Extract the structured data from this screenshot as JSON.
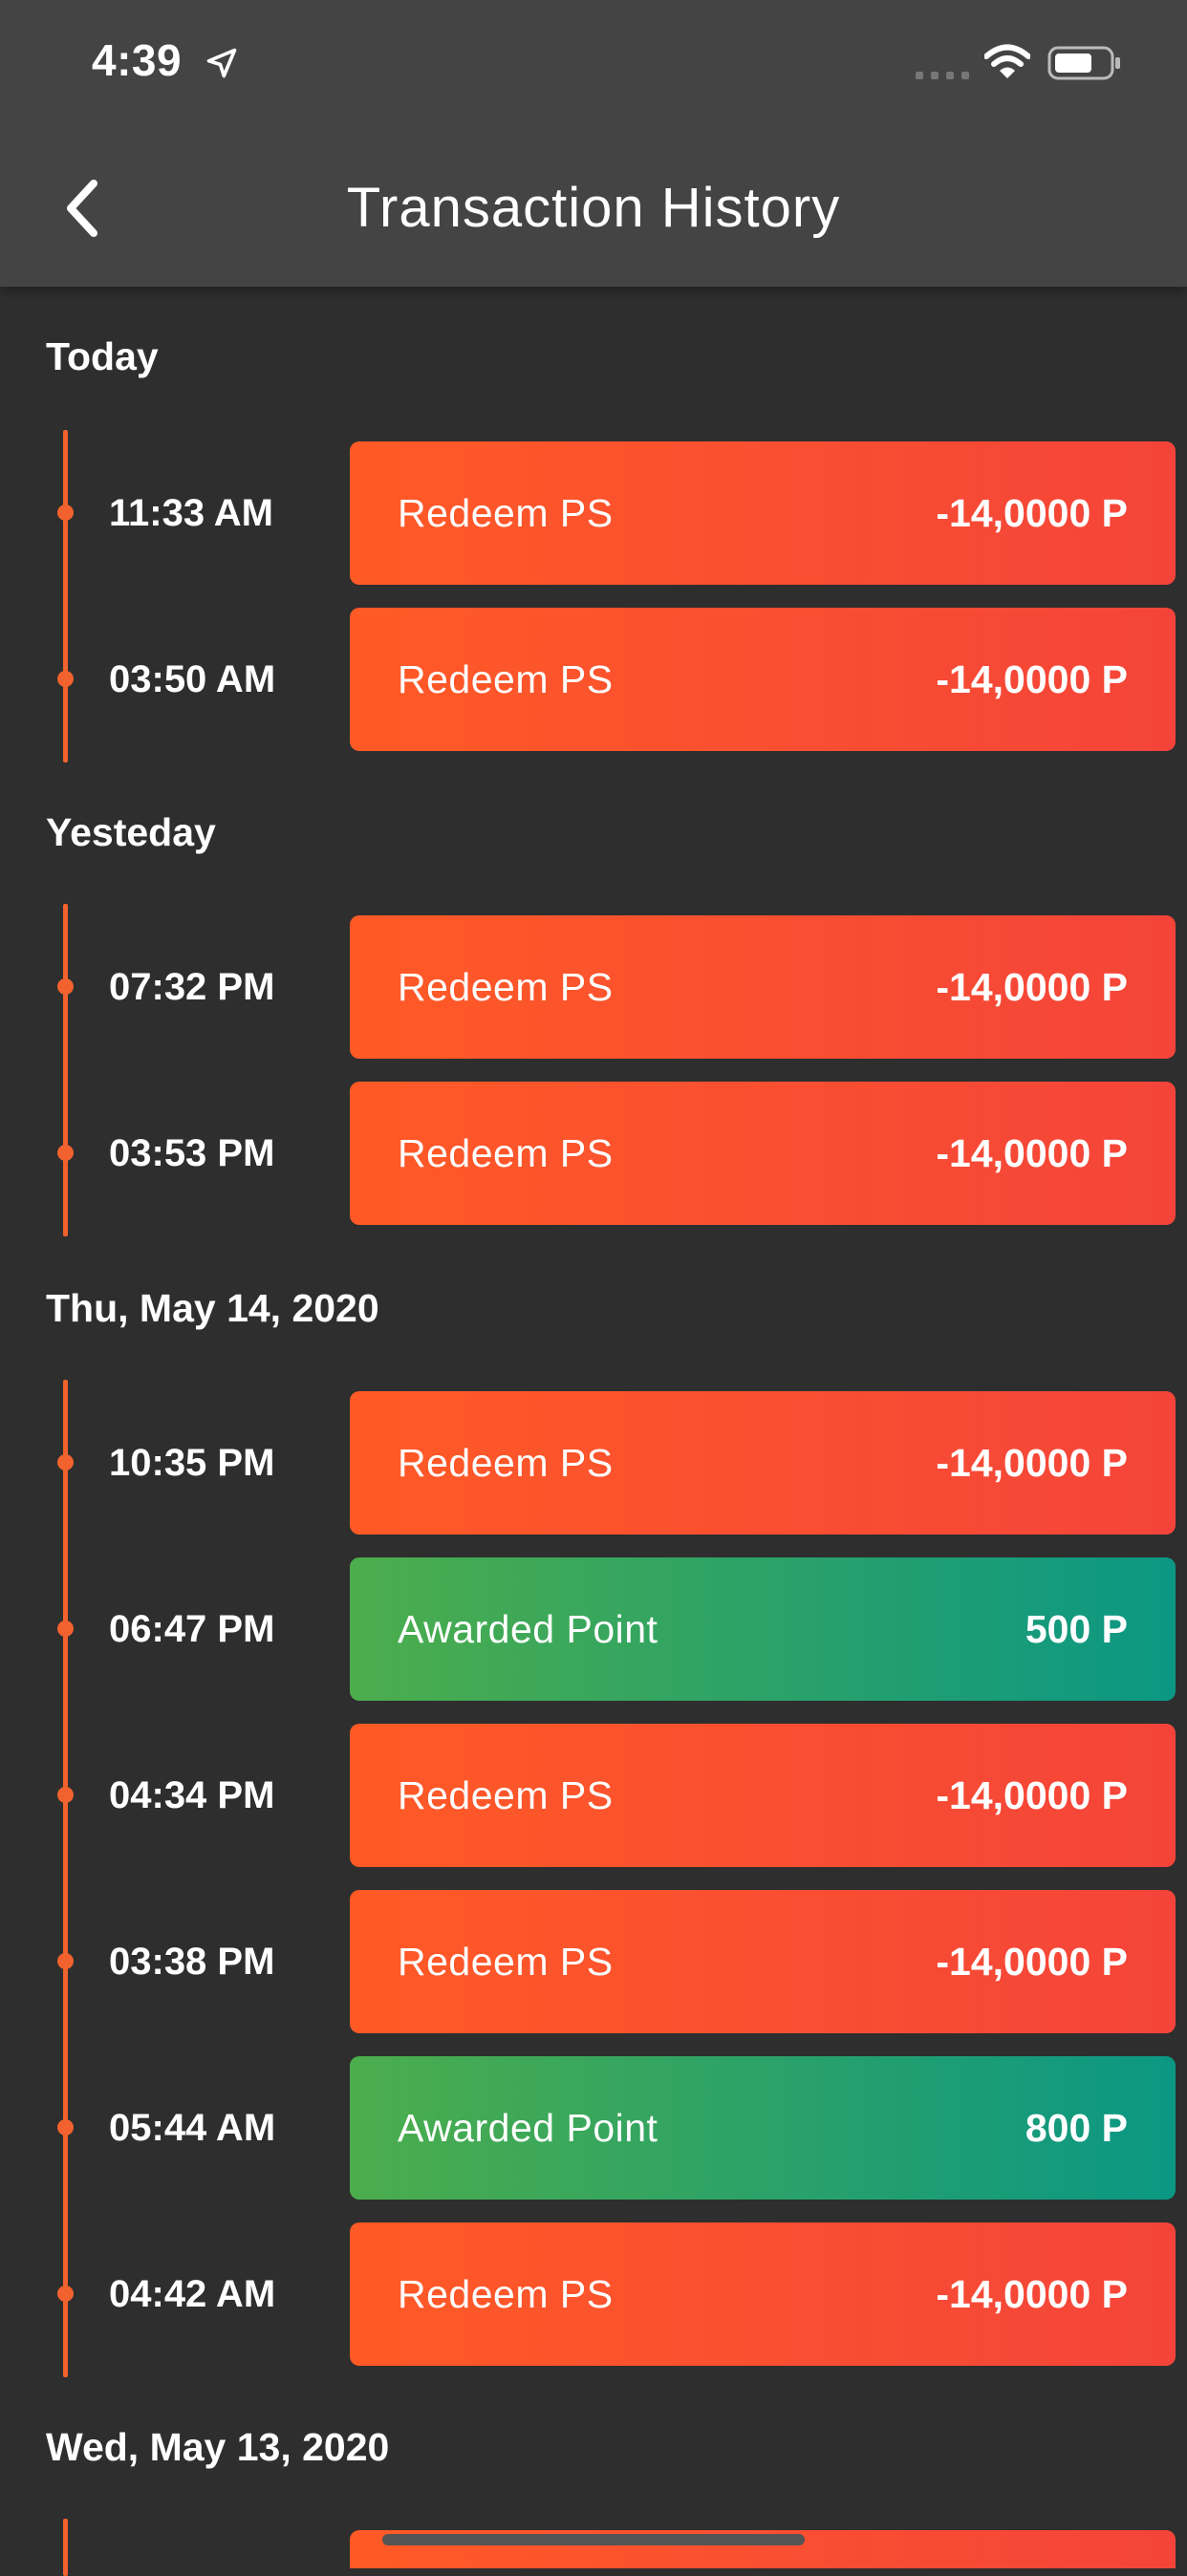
{
  "status_bar": {
    "time": "4:39"
  },
  "header": {
    "title": "Transaction History"
  },
  "sections": [
    {
      "title": "Today",
      "transactions": [
        {
          "time": "11:33 AM",
          "label": "Redeem PS",
          "amount": "-14,0000 P",
          "type": "redeem"
        },
        {
          "time": "03:50 AM",
          "label": "Redeem PS",
          "amount": "-14,0000 P",
          "type": "redeem"
        }
      ]
    },
    {
      "title": "Yesteday",
      "transactions": [
        {
          "time": "07:32 PM",
          "label": "Redeem PS",
          "amount": "-14,0000 P",
          "type": "redeem"
        },
        {
          "time": "03:53 PM",
          "label": "Redeem PS",
          "amount": "-14,0000 P",
          "type": "redeem"
        }
      ]
    },
    {
      "title": "Thu, May 14, 2020",
      "transactions": [
        {
          "time": "10:35 PM",
          "label": "Redeem PS",
          "amount": "-14,0000 P",
          "type": "redeem"
        },
        {
          "time": "06:47 PM",
          "label": "Awarded Point",
          "amount": "500 P",
          "type": "award"
        },
        {
          "time": "04:34 PM",
          "label": "Redeem PS",
          "amount": "-14,0000 P",
          "type": "redeem"
        },
        {
          "time": "03:38 PM",
          "label": "Redeem PS",
          "amount": "-14,0000 P",
          "type": "redeem"
        },
        {
          "time": "05:44 AM",
          "label": "Awarded Point",
          "amount": "800 P",
          "type": "award"
        },
        {
          "time": "04:42 AM",
          "label": "Redeem PS",
          "amount": "-14,0000 P",
          "type": "redeem"
        }
      ]
    },
    {
      "title": "Wed, May 13, 2020",
      "transactions": [
        {
          "time": "",
          "label": "",
          "amount": "",
          "type": "redeem"
        }
      ]
    }
  ],
  "colors": {
    "background": "#2e2e2e",
    "header": "#444444",
    "accent": "#f2622e",
    "redeem_start": "#ff5a26",
    "redeem_end": "#f4443a",
    "award_start": "#4cad4c",
    "award_end": "#0b9784"
  },
  "icons": {
    "back": "chevron-left-icon",
    "location": "location-arrow-icon",
    "signal": "signal-icon",
    "wifi": "wifi-icon",
    "battery": "battery-icon"
  }
}
